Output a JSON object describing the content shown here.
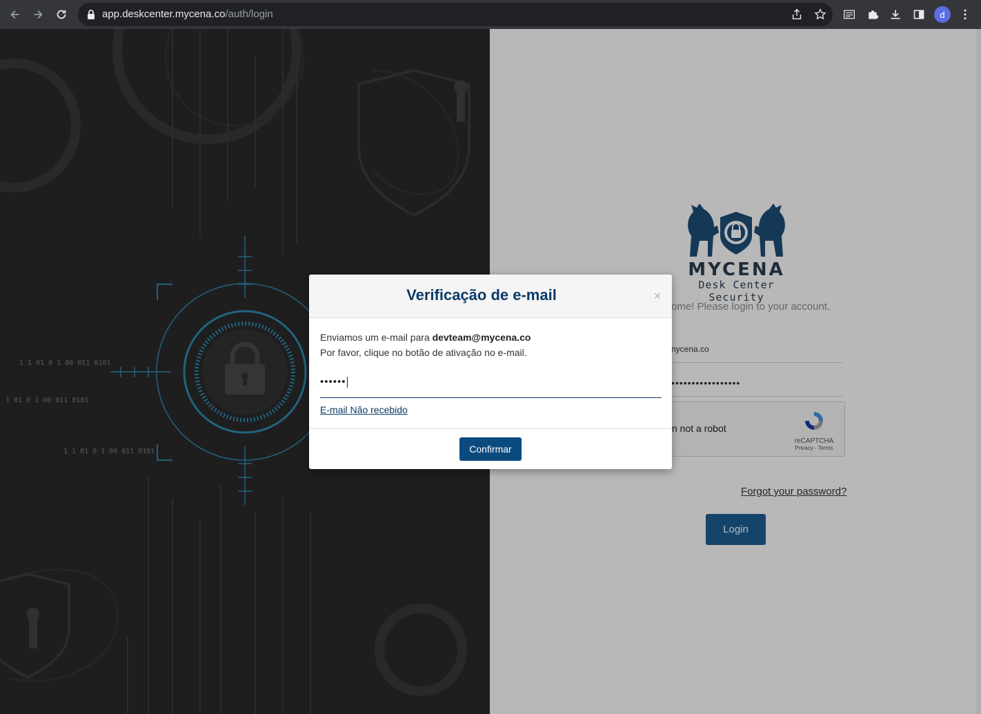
{
  "browser": {
    "url_host": "app.deskcenter.mycena.co",
    "url_path": "/auth/login",
    "profile_initial": "d"
  },
  "brand": {
    "name": "MYCENA",
    "tagline": "Desk Center Security"
  },
  "login": {
    "welcome": "ome! Please login to your account.",
    "email_value": "nycena.co",
    "password_value": "•••••••••••••••••",
    "recaptcha_label": "n not a robot",
    "recaptcha_brand": "reCAPTCHA",
    "recaptcha_legal": "Privacy - Terms",
    "forgot_password": "Forgot your password?",
    "login_button": "Login"
  },
  "modal": {
    "title": "Verificação de e-mail",
    "close": "×",
    "line1_prefix": "Enviamos um e-mail para ",
    "email": "devteam@mycena.co",
    "line2": "Por favor, clique no botão de ativação no e-mail.",
    "code_value": "••••••",
    "resend_link": "E-mail Não recebido",
    "confirm_button": "Confirmar"
  },
  "binary_rows": [
    "1 1     01  0  1   00  011         0101",
    "1   01 0 1  00 011       0101",
    "1 1    01  0  1   00  011         0101"
  ]
}
